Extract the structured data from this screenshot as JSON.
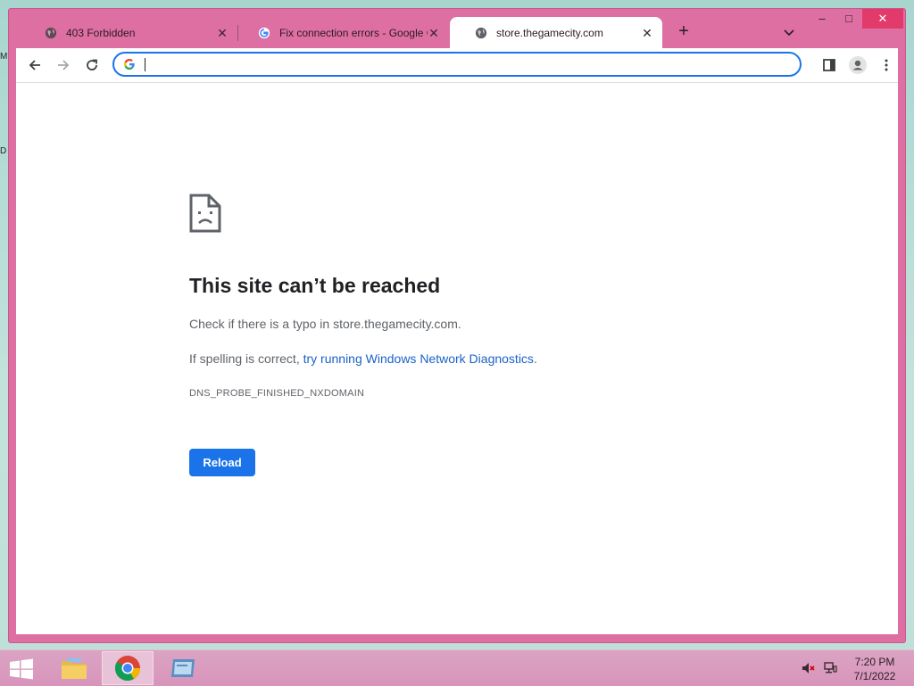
{
  "desktop": {
    "edge_label_1": "M",
    "edge_label_2": "D"
  },
  "tabs": [
    {
      "title": "403 Forbidden",
      "icon": "globe-icon",
      "active": false
    },
    {
      "title": "Fix connection errors - Google Chrome Help",
      "icon": "google-icon",
      "active": false
    },
    {
      "title": "store.thegamecity.com",
      "icon": "globe-icon",
      "active": true
    }
  ],
  "window_controls": {
    "minimize": "–",
    "maximize": "□",
    "close": "✕"
  },
  "omnibox": {
    "value": "",
    "placeholder": ""
  },
  "error_page": {
    "title": "This site can’t be reached",
    "line1": "Check if there is a typo in store.thegamecity.com.",
    "line2_prefix": "If spelling is correct, ",
    "line2_link": "try running Windows Network Diagnostics",
    "line2_suffix": ".",
    "error_code": "DNS_PROBE_FINISHED_NXDOMAIN",
    "reload_label": "Reload"
  },
  "taskbar": {
    "apps": [
      "file-explorer-icon",
      "chrome-icon",
      "app-window-icon"
    ],
    "time": "7:20 PM",
    "date": "7/1/2022"
  },
  "colors": {
    "window_frame": "#de6fa2",
    "accent": "#1a73e8",
    "link": "#1a62c8",
    "taskbar": "#d894bb"
  }
}
